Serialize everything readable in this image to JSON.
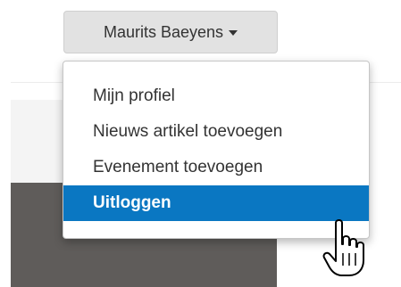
{
  "user_menu": {
    "button_label": "Maurits Baeyens",
    "items": [
      {
        "label": "Mijn profiel"
      },
      {
        "label": "Nieuws artikel toevoegen"
      },
      {
        "label": "Evenement toevoegen"
      },
      {
        "label": "Uitloggen",
        "state": "hovered"
      }
    ]
  },
  "colors": {
    "active_item_bg": "#0a77c2",
    "toggle_bg": "#e2e2e2",
    "background_dark": "#5f5c5a"
  },
  "cursor": {
    "icon": "hand-pointer-icon"
  }
}
